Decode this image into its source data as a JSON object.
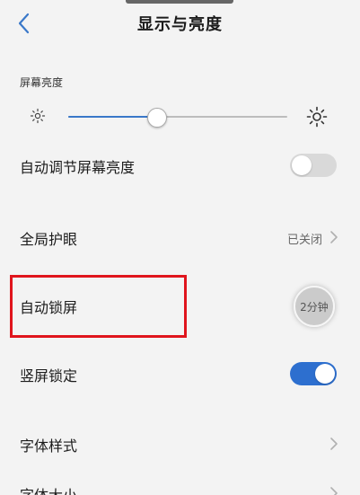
{
  "header": {
    "title": "显示与亮度",
    "back_icon": "chevron-left-icon"
  },
  "brightness": {
    "section_label": "屏幕亮度",
    "level_fraction": 0.4,
    "low_icon": "sun-small-icon",
    "high_icon": "sun-large-icon",
    "accent_color": "#3a78c9"
  },
  "rows": {
    "auto_brightness": {
      "label": "自动调节屏幕亮度",
      "toggle": "off"
    },
    "eye_protection": {
      "label": "全局护眼",
      "value": "已关闭"
    },
    "auto_lock": {
      "label": "自动锁屏",
      "value": "2分钟"
    },
    "portrait_lock": {
      "label": "竖屏锁定",
      "toggle": "on"
    },
    "font_style": {
      "label": "字体样式"
    },
    "font_size": {
      "label": "字体大小"
    }
  },
  "colors": {
    "toggle_on": "#2d6fcf",
    "toggle_off": "#d9d9d9",
    "highlight": "#e0151d",
    "background": "#f3f3f3"
  }
}
